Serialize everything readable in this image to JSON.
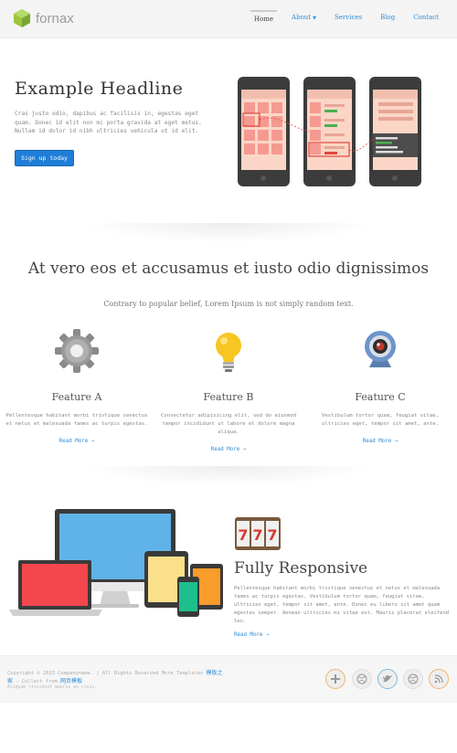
{
  "brand": {
    "name": "fornax"
  },
  "nav": {
    "items": [
      {
        "label": "Home",
        "active": true
      },
      {
        "label": "About",
        "has_dropdown": true
      },
      {
        "label": "Services"
      },
      {
        "label": "Blog"
      },
      {
        "label": "Contact"
      }
    ]
  },
  "hero": {
    "title": "Example Headline",
    "text": "Cras justo odio, dapibus ac facilisis in, egestas eget quam. Donec id elit non mi porta gravida at eget metus. Nullam id dolor id nibh ultricies vehicula ut id elit.",
    "button": "Sign up today"
  },
  "section": {
    "title": "At vero eos et accusamus et iusto odio dignissimos",
    "subtitle": "Contrary to popular belief, Lorem Ipsum is not simply random text."
  },
  "features": [
    {
      "title": "Feature A",
      "icon": "gear-icon",
      "text": "Pellentesque habitant morbi tristique senectus et netus et malesuada fames ac turpis egestas.",
      "link": "Read More →"
    },
    {
      "title": "Feature B",
      "icon": "lightbulb-icon",
      "text": "Consectetur adipisicing elit, sed do eiusmod tempor incididunt ut labore et dolore magna aliqua.",
      "link": "Read More →"
    },
    {
      "title": "Feature C",
      "icon": "webcam-icon",
      "text": "Vestibulum tortor quam, feugiat vitae, ultricies eget, tempor sit amet, ante.",
      "link": "Read More →"
    }
  ],
  "responsive": {
    "slot_digits": [
      "7",
      "7",
      "7"
    ],
    "title": "Fully Responsive",
    "text": "Pellentesque habitant morbi tristique senectus et netus et malesuada fames ac turpis egestas. Vestibulum tortor quam, feugiat vitae, ultricies eget, tempor sit amet, ante. Donec eu libero sit amet quam egestas semper. Aenean ultricies mi vitae est. Mauris placerat eleifend leo.",
    "link": "Read More →"
  },
  "footer": {
    "copyright": "Copyright © 2013 Companyname. | All Rights Reserved More Templates",
    "cn_link_1": "模板之家",
    "collect_text": " - Collect from",
    "cn_link_2": "网页模板",
    "small_text": "Aliquam tincidunt mauris eu risus.",
    "social": [
      "plus-icon",
      "dribbble-icon",
      "twitter-icon",
      "dribbble-icon",
      "rss-icon"
    ]
  },
  "colors": {
    "accent": "#2e8bd6",
    "button": "#1f7ed8",
    "phone_screen": "#f7a99f",
    "social_orange": "#f5b569",
    "social_blue": "#7bbbe3"
  }
}
